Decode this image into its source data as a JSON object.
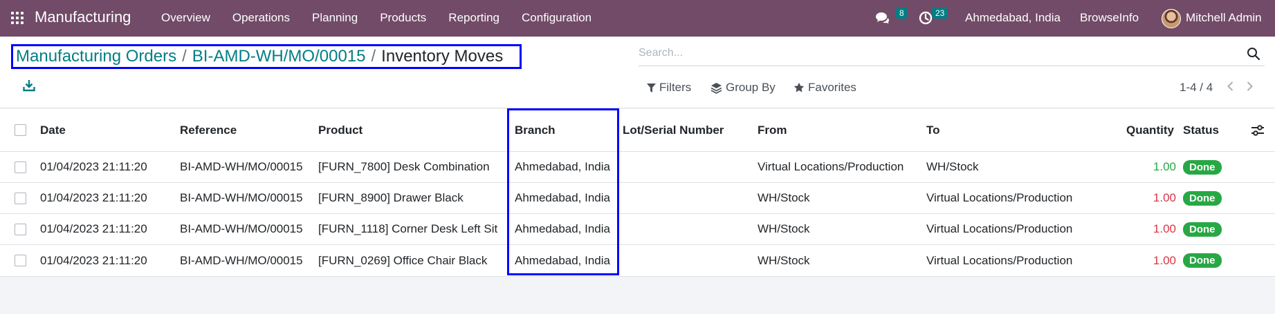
{
  "navbar": {
    "app_name": "Manufacturing",
    "menu": [
      "Overview",
      "Operations",
      "Planning",
      "Products",
      "Reporting",
      "Configuration"
    ],
    "messages_count": "8",
    "activities_count": "23",
    "branch": "Ahmedabad, India",
    "company": "BrowseInfo",
    "user": "Mitchell Admin"
  },
  "breadcrumb": {
    "items": [
      "Manufacturing Orders",
      "BI-AMD-WH/MO/00015"
    ],
    "current": "Inventory Moves"
  },
  "search": {
    "placeholder": "Search..."
  },
  "filters": {
    "filters": "Filters",
    "group_by": "Group By",
    "favorites": "Favorites"
  },
  "pager": {
    "text": "1-4 / 4"
  },
  "table": {
    "headers": {
      "date": "Date",
      "reference": "Reference",
      "product": "Product",
      "branch": "Branch",
      "lot": "Lot/Serial Number",
      "from": "From",
      "to": "To",
      "quantity": "Quantity",
      "status": "Status"
    },
    "rows": [
      {
        "date": "01/04/2023 21:11:20",
        "reference": "BI-AMD-WH/MO/00015",
        "product": "[FURN_7800] Desk Combination",
        "branch": "Ahmedabad, India",
        "lot": "",
        "from": "Virtual Locations/Production",
        "to": "WH/Stock",
        "quantity": "1.00",
        "status": "Done"
      },
      {
        "date": "01/04/2023 21:11:20",
        "reference": "BI-AMD-WH/MO/00015",
        "product": "[FURN_8900] Drawer Black",
        "branch": "Ahmedabad, India",
        "lot": "",
        "from": "WH/Stock",
        "to": "Virtual Locations/Production",
        "quantity": "1.00",
        "status": "Done"
      },
      {
        "date": "01/04/2023 21:11:20",
        "reference": "BI-AMD-WH/MO/00015",
        "product": "[FURN_1118] Corner Desk Left Sit",
        "branch": "Ahmedabad, India",
        "lot": "",
        "from": "WH/Stock",
        "to": "Virtual Locations/Production",
        "quantity": "1.00",
        "status": "Done"
      },
      {
        "date": "01/04/2023 21:11:20",
        "reference": "BI-AMD-WH/MO/00015",
        "product": "[FURN_0269] Office Chair Black",
        "branch": "Ahmedabad, India",
        "lot": "",
        "from": "WH/Stock",
        "to": "Virtual Locations/Production",
        "quantity": "1.00",
        "status": "Done"
      }
    ]
  },
  "colors": {
    "navbar": "#714b67",
    "link": "#017e84",
    "highlight_box": "#0000ff",
    "done_badge": "#28a745",
    "qty_in": "#28a745",
    "qty_out": "#dc3545"
  },
  "icons": [
    "apps-grid-icon",
    "chat-icon",
    "clock-icon",
    "download-icon",
    "search-icon",
    "filter-icon",
    "layers-icon",
    "star-icon",
    "chevron-left-icon",
    "chevron-right-icon",
    "column-settings-icon"
  ]
}
